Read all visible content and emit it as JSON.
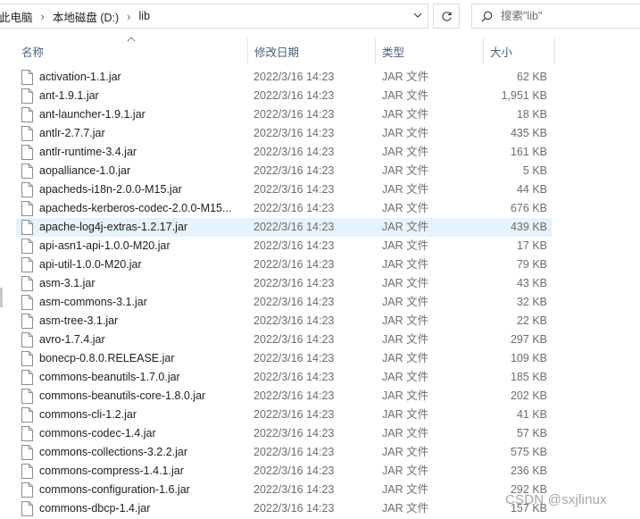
{
  "address_bar": {
    "breadcrumbs": [
      "此电脑",
      "本地磁盘 (D:)",
      "lib"
    ]
  },
  "search": {
    "placeholder": "搜索\"lib\""
  },
  "columns": {
    "name": "名称",
    "date": "修改日期",
    "type": "类型",
    "size": "大小"
  },
  "files": [
    {
      "name": "activation-1.1.jar",
      "date": "2022/3/16 14:23",
      "type": "JAR 文件",
      "size": "62 KB"
    },
    {
      "name": "ant-1.9.1.jar",
      "date": "2022/3/16 14:23",
      "type": "JAR 文件",
      "size": "1,951 KB"
    },
    {
      "name": "ant-launcher-1.9.1.jar",
      "date": "2022/3/16 14:23",
      "type": "JAR 文件",
      "size": "18 KB"
    },
    {
      "name": "antlr-2.7.7.jar",
      "date": "2022/3/16 14:23",
      "type": "JAR 文件",
      "size": "435 KB"
    },
    {
      "name": "antlr-runtime-3.4.jar",
      "date": "2022/3/16 14:23",
      "type": "JAR 文件",
      "size": "161 KB"
    },
    {
      "name": "aopalliance-1.0.jar",
      "date": "2022/3/16 14:23",
      "type": "JAR 文件",
      "size": "5 KB"
    },
    {
      "name": "apacheds-i18n-2.0.0-M15.jar",
      "date": "2022/3/16 14:23",
      "type": "JAR 文件",
      "size": "44 KB"
    },
    {
      "name": "apacheds-kerberos-codec-2.0.0-M15...",
      "date": "2022/3/16 14:23",
      "type": "JAR 文件",
      "size": "676 KB"
    },
    {
      "name": "apache-log4j-extras-1.2.17.jar",
      "date": "2022/3/16 14:23",
      "type": "JAR 文件",
      "size": "439 KB"
    },
    {
      "name": "api-asn1-api-1.0.0-M20.jar",
      "date": "2022/3/16 14:23",
      "type": "JAR 文件",
      "size": "17 KB"
    },
    {
      "name": "api-util-1.0.0-M20.jar",
      "date": "2022/3/16 14:23",
      "type": "JAR 文件",
      "size": "79 KB"
    },
    {
      "name": "asm-3.1.jar",
      "date": "2022/3/16 14:23",
      "type": "JAR 文件",
      "size": "43 KB"
    },
    {
      "name": "asm-commons-3.1.jar",
      "date": "2022/3/16 14:23",
      "type": "JAR 文件",
      "size": "32 KB"
    },
    {
      "name": "asm-tree-3.1.jar",
      "date": "2022/3/16 14:23",
      "type": "JAR 文件",
      "size": "22 KB"
    },
    {
      "name": "avro-1.7.4.jar",
      "date": "2022/3/16 14:23",
      "type": "JAR 文件",
      "size": "297 KB"
    },
    {
      "name": "bonecp-0.8.0.RELEASE.jar",
      "date": "2022/3/16 14:23",
      "type": "JAR 文件",
      "size": "109 KB"
    },
    {
      "name": "commons-beanutils-1.7.0.jar",
      "date": "2022/3/16 14:23",
      "type": "JAR 文件",
      "size": "185 KB"
    },
    {
      "name": "commons-beanutils-core-1.8.0.jar",
      "date": "2022/3/16 14:23",
      "type": "JAR 文件",
      "size": "202 KB"
    },
    {
      "name": "commons-cli-1.2.jar",
      "date": "2022/3/16 14:23",
      "type": "JAR 文件",
      "size": "41 KB"
    },
    {
      "name": "commons-codec-1.4.jar",
      "date": "2022/3/16 14:23",
      "type": "JAR 文件",
      "size": "57 KB"
    },
    {
      "name": "commons-collections-3.2.2.jar",
      "date": "2022/3/16 14:23",
      "type": "JAR 文件",
      "size": "575 KB"
    },
    {
      "name": "commons-compress-1.4.1.jar",
      "date": "2022/3/16 14:23",
      "type": "JAR 文件",
      "size": "236 KB"
    },
    {
      "name": "commons-configuration-1.6.jar",
      "date": "2022/3/16 14:23",
      "type": "JAR 文件",
      "size": "292 KB"
    },
    {
      "name": "commons-dbcp-1.4.jar",
      "date": "2022/3/16 14:23",
      "type": "JAR 文件",
      "size": "157 KB"
    }
  ],
  "selected_file": "apache-log4j-extras-1.2.17.jar",
  "watermark": "CSDN @sxjlinux",
  "colors": {
    "selected_row": "#e5f3ff",
    "header_text": "#4c607a",
    "secondary_text": "#6d6d6d"
  },
  "icons": {
    "file": "blank-file-icon",
    "dropdown": "chevron-down-icon",
    "refresh": "refresh-icon",
    "search": "search-icon",
    "sort": "sort-ascending-caret-icon"
  }
}
